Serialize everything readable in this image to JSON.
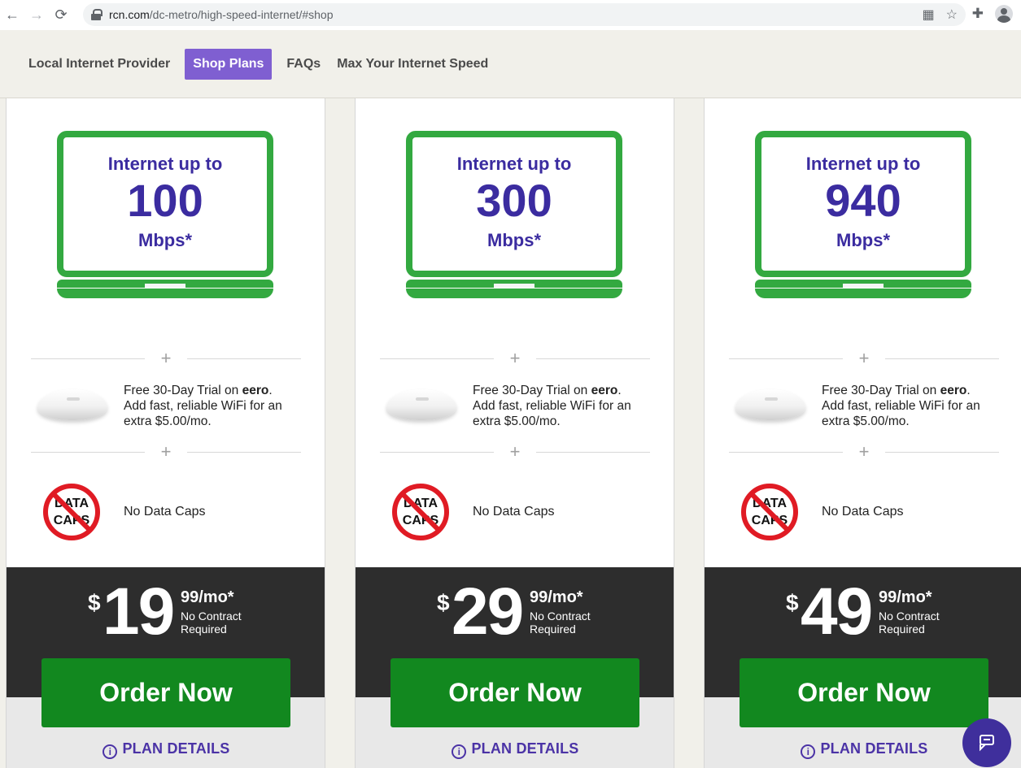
{
  "browser": {
    "url_main": "rcn.com",
    "url_path": "/dc-metro/high-speed-internet/#shop"
  },
  "site_nav": {
    "items": [
      {
        "label": "Local Internet Provider"
      },
      {
        "label": "Shop Plans"
      },
      {
        "label": "FAQs"
      },
      {
        "label": "Max Your Internet Speed"
      }
    ]
  },
  "plans": [
    {
      "speed_prefix": "Internet up to",
      "speed": "100",
      "unit": "Mbps*",
      "eero_line1_pre": "Free 30-Day Trial on ",
      "eero_bold": "eero",
      "eero_line1_post": ".",
      "eero_line2": "Add fast, reliable WiFi for an extra $5.00/mo.",
      "caps_top": "DATA",
      "caps_bottom": "CAPS",
      "no_caps": "No Data Caps",
      "currency": "$",
      "dollars": "19",
      "cents": "99/mo*",
      "contract": "No Contract Required",
      "order": "Order Now",
      "details": "PLAN DETAILS"
    },
    {
      "speed_prefix": "Internet up to",
      "speed": "300",
      "unit": "Mbps*",
      "eero_line1_pre": "Free 30-Day Trial on ",
      "eero_bold": "eero",
      "eero_line1_post": ".",
      "eero_line2": "Add fast, reliable WiFi for an extra $5.00/mo.",
      "caps_top": "DATA",
      "caps_bottom": "CAPS",
      "no_caps": "No Data Caps",
      "currency": "$",
      "dollars": "29",
      "cents": "99/mo*",
      "contract": "No Contract Required",
      "order": "Order Now",
      "details": "PLAN DETAILS"
    },
    {
      "speed_prefix": "Internet up to",
      "speed": "940",
      "unit": "Mbps*",
      "eero_line1_pre": "Free 30-Day Trial on ",
      "eero_bold": "eero",
      "eero_line1_post": ".",
      "eero_line2": "Add fast, reliable WiFi for an extra $5.00/mo.",
      "caps_top": "DATA",
      "caps_bottom": "CAPS",
      "no_caps": "No Data Caps",
      "currency": "$",
      "dollars": "49",
      "cents": "99/mo*",
      "contract": "No Contract Required",
      "order": "Order Now",
      "details": "PLAN DETAILS"
    }
  ],
  "colors": {
    "accent_purple": "#7f5fd1",
    "text_purple": "#3b2ca0",
    "laptop_green": "#33a940",
    "order_green": "#12881f",
    "price_band": "#2d2d2d"
  },
  "icons": {
    "back": "back-arrow-icon",
    "forward": "forward-arrow-icon",
    "reload": "reload-icon",
    "lock": "lock-icon",
    "qr": "qr-code-icon",
    "star": "star-icon",
    "extensions": "puzzle-icon",
    "profile": "profile-icon",
    "chat": "chat-icon",
    "info": "info-icon"
  }
}
